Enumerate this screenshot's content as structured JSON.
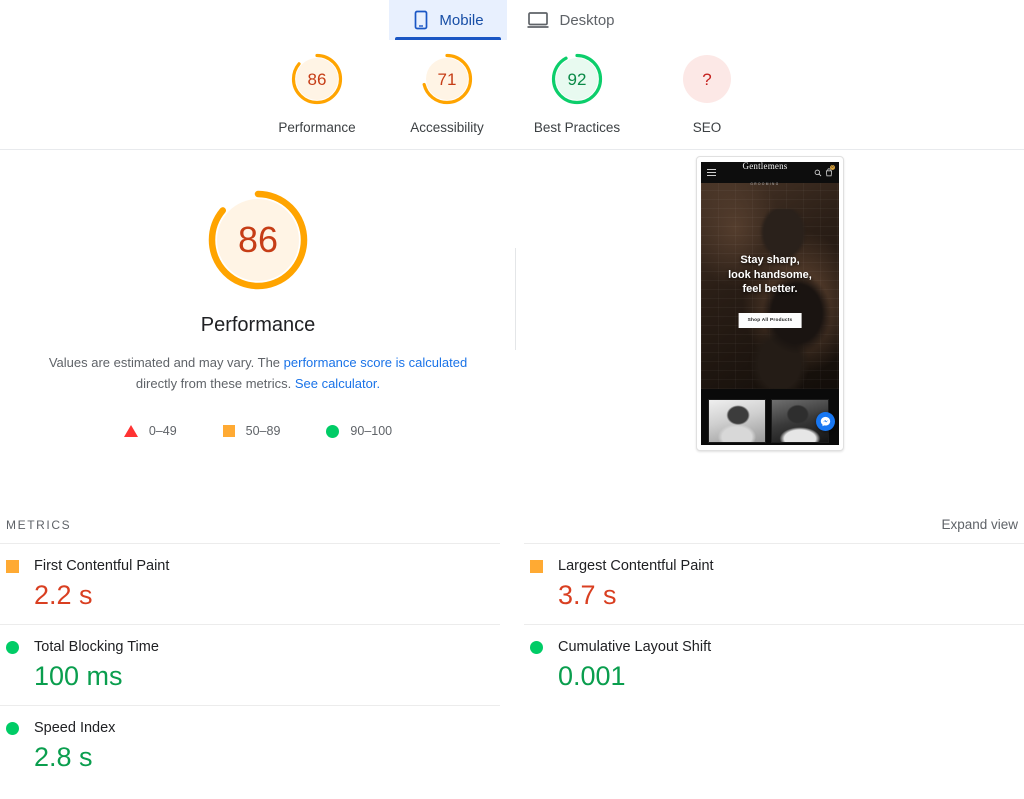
{
  "tabs": [
    {
      "label": "Mobile",
      "icon": "mobile-phone-icon",
      "active": true
    },
    {
      "label": "Desktop",
      "icon": "desktop-monitor-icon",
      "active": false
    }
  ],
  "category_scores": [
    {
      "label": "Performance",
      "value": "86",
      "pct": 86,
      "color": "#ffa400",
      "fill": "#fff4e5",
      "text": "#c63d16"
    },
    {
      "label": "Accessibility",
      "value": "71",
      "pct": 71,
      "color": "#ffa400",
      "fill": "#fff4e5",
      "text": "#c63d16"
    },
    {
      "label": "Best Practices",
      "value": "92",
      "pct": 92,
      "color": "#0cce6b",
      "fill": "#e8faf0",
      "text": "#0a8a47"
    },
    {
      "label": "SEO",
      "value": "?",
      "pct": 0,
      "color": "#fce8e6",
      "fill": "#fce8e6",
      "text": "#c5221f"
    }
  ],
  "hero": {
    "score": "86",
    "score_pct": 86,
    "title": "Performance",
    "desc_part1": "Values are estimated and may vary. The ",
    "desc_link1": "performance score is calculated",
    "desc_part2": " directly from these metrics. ",
    "desc_link2": "See calculator.",
    "legend": [
      {
        "shape": "triangle",
        "range": "0–49",
        "color": "#ff3333"
      },
      {
        "shape": "square",
        "range": "50–89",
        "color": "#ffaa33"
      },
      {
        "shape": "circle",
        "range": "90–100",
        "color": "#00cc66"
      }
    ]
  },
  "thumbnail": {
    "alt": "Mobile page screenshot",
    "logo_main": "Gentlemens",
    "logo_sub": "GROOMING",
    "cart_badge": "0",
    "hero_line1": "Stay sharp,",
    "hero_line2": "look handsome,",
    "hero_line3": "feel better.",
    "cta": "Shop All Products",
    "icons": {
      "menu": "hamburger-menu-icon",
      "search": "search-icon",
      "cart": "shopping-cart-icon",
      "chat": "messenger-chat-icon"
    }
  },
  "metrics_section": {
    "title": "METRICS",
    "expand_label": "Expand view"
  },
  "metrics": [
    {
      "name": "First Contentful Paint",
      "value": "2.2 s",
      "status": "average",
      "marker": "square",
      "color": "#ffaa33",
      "value_color": "#d93f21"
    },
    {
      "name": "Largest Contentful Paint",
      "value": "3.7 s",
      "status": "average",
      "marker": "square",
      "color": "#ffaa33",
      "value_color": "#d93f21"
    },
    {
      "name": "Total Blocking Time",
      "value": "100 ms",
      "status": "good",
      "marker": "circle",
      "color": "#00cc66",
      "value_color": "#0a9e4e"
    },
    {
      "name": "Cumulative Layout Shift",
      "value": "0.001",
      "status": "good",
      "marker": "circle",
      "color": "#00cc66",
      "value_color": "#0a9e4e"
    },
    {
      "name": "Speed Index",
      "value": "2.8 s",
      "status": "good",
      "marker": "circle",
      "color": "#00cc66",
      "value_color": "#0a9e4e"
    }
  ]
}
